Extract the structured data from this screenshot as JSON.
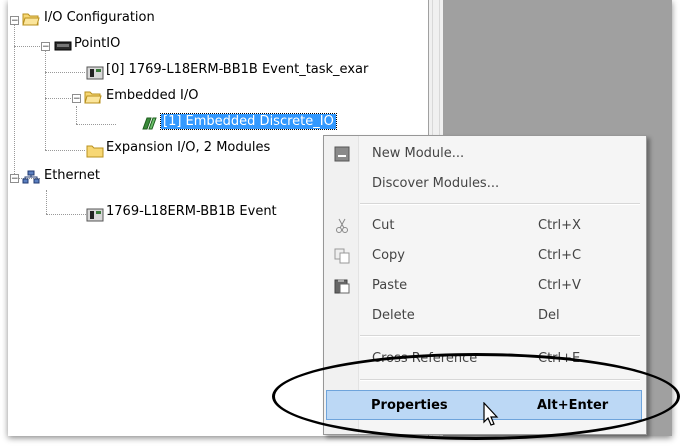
{
  "tree": {
    "root": {
      "label": "I/O Configuration",
      "expander": "−"
    },
    "pointio": {
      "label": "PointIO",
      "expander": "−"
    },
    "controller_module": {
      "label": "[0] 1769-L18ERM-BB1B Event_task_exar"
    },
    "embedded_io": {
      "label": "Embedded I/O",
      "expander": "−"
    },
    "embedded_discrete": {
      "label": "[1] Embedded Discrete_IO"
    },
    "expansion_io": {
      "label": "Expansion I/O, 2 Modules"
    },
    "ethernet": {
      "label": "Ethernet",
      "expander": "−"
    },
    "ethernet_module": {
      "label": "1769-L18ERM-BB1B Event"
    }
  },
  "context_menu": {
    "new_module": "New Module...",
    "discover_modules": "Discover Modules...",
    "cut": "Cut",
    "cut_sc": "Ctrl+X",
    "copy": "Copy",
    "copy_sc": "Ctrl+C",
    "paste": "Paste",
    "paste_sc": "Ctrl+V",
    "delete": "Delete",
    "delete_sc": "Del",
    "cross_reference": "Cross Reference",
    "cross_reference_sc": "Ctrl+E",
    "properties": "Properties",
    "properties_sc": "Alt+Enter"
  },
  "colors": {
    "selection": "#3399ff",
    "menu_highlight": "#bcd8f5",
    "right_pane": "#a0a0a0"
  }
}
